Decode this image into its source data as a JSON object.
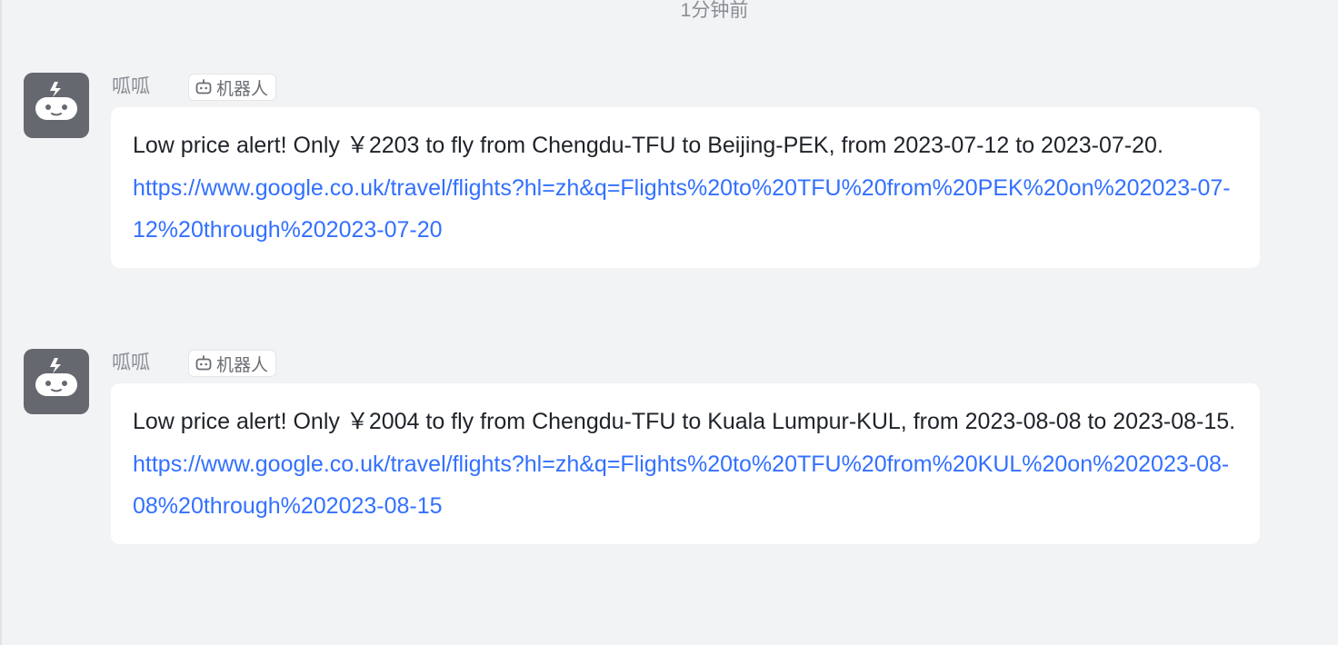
{
  "timestamp": "1分钟前",
  "messages": [
    {
      "sender": "呱呱",
      "tag": "机器人",
      "text": "Low price alert! Only ￥2203 to fly from Chengdu-TFU to Beijing-PEK, from 2023-07-12 to 2023-07-20.",
      "link": "https://www.google.co.uk/travel/flights?hl=zh&q=Flights%20to%20TFU%20from%20PEK%20on%202023-07-12%20through%202023-07-20"
    },
    {
      "sender": "呱呱",
      "tag": "机器人",
      "text": "Low price alert! Only ￥2004 to fly from Chengdu-TFU to Kuala Lumpur-KUL, from 2023-08-08 to 2023-08-15.",
      "link": "https://www.google.co.uk/travel/flights?hl=zh&q=Flights%20to%20TFU%20from%20KUL%20on%202023-08-08%20through%202023-08-15"
    }
  ],
  "colors": {
    "link": "#3370ff",
    "avatar_bg": "#65696f",
    "page_bg": "#f2f3f5"
  }
}
